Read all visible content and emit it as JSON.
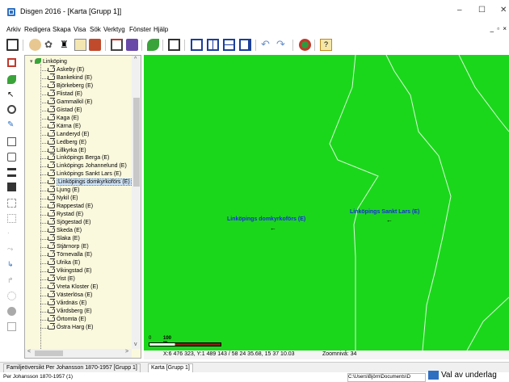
{
  "window": {
    "title": "Disgen 2016 - [Karta [Grupp 1]]",
    "minimize": "–",
    "maximize": "☐",
    "close": "✕"
  },
  "menu": [
    "Arkiv",
    "Redigera",
    "Skapa",
    "Visa",
    "Sök",
    "Verktyg",
    "Fönster",
    "Hjälp"
  ],
  "mdi_controls": "_ ▫ ×",
  "tree": {
    "root": "Linköping",
    "selected_index": 14,
    "items": [
      "Askeby (E)",
      "Bankekind (E)",
      "Björkeberg (E)",
      "Flistad (E)",
      "Gammalkil (E)",
      "Gistad (E)",
      "Kaga (E)",
      "Kärna (E)",
      "Landeryd (E)",
      "Ledberg (E)",
      "Lillkyrka (E)",
      "Linköpings Berga (E)",
      "Linköpings Johannelund (E)",
      "Linköpings Sankt Lars (E)",
      "Linköpings domkyrkoförs (E)",
      "Ljung (E)",
      "Nykil (E)",
      "Rappestad (E)",
      "Rystad (E)",
      "Sjögestad (E)",
      "Skeda (E)",
      "Slaka (E)",
      "Stjärnorp (E)",
      "Törnevalla (E)",
      "Ulrika (E)",
      "Vikingstad (E)",
      "Vist (E)",
      "Vreta Kloster (E)",
      "Västerlösa (E)",
      "Vårdnäs (E)",
      "Vårdsberg (E)",
      "Örtomta (E)",
      "Östra Harg (E)"
    ]
  },
  "map": {
    "labels": [
      {
        "text": "Linköpings domkyrkoförs (E)"
      },
      {
        "text": "Linköpings Sankt Lars (E)"
      }
    ],
    "marker": "←",
    "scale_label": "100 m",
    "scale_zero": "0",
    "bg_color": "#1bd71b",
    "label_color": "#1a2ee0"
  },
  "status": {
    "coords": "X:6 476 323, Y:1 489 143 / 58 24 35.68, 15 37 10.03",
    "zoom": "Zoomnivå: 34"
  },
  "tabs": [
    "Familjeöversikt Per Johansson 1870-1957 [Grupp 1]",
    "Karta [Grupp 1]"
  ],
  "bottom": {
    "person": "Per Johansson 1870-1957 (1)",
    "path": "C:\\Users\\Björn\\Documents\\D",
    "notification": "Val av underlag"
  },
  "icons": {
    "toolbar": [
      "printer-icon",
      "person-icon",
      "family-tree-icon",
      "binoculars-icon",
      "edit-icon",
      "book-icon",
      "home-icon",
      "gallery-icon",
      "leaf-icon",
      "chart-icon",
      "window-single-icon",
      "window-split-vertical-icon",
      "window-split-horizontal-icon",
      "window-cascade-icon",
      "undo-icon",
      "redo-icon",
      "globe-icon",
      "help-icon"
    ],
    "left": [
      "close-map-icon",
      "leaf-icon",
      "pointer-icon",
      "zoom-icon",
      "pen-icon",
      "ruler-icon",
      "copy-icon",
      "list-icon",
      "grid-icon",
      "layers-icon",
      "table-icon",
      "dot-icon",
      "route-icon",
      "route-alt-icon",
      "branch-icon",
      "compass-icon",
      "circle-icon",
      "square-icon"
    ]
  }
}
